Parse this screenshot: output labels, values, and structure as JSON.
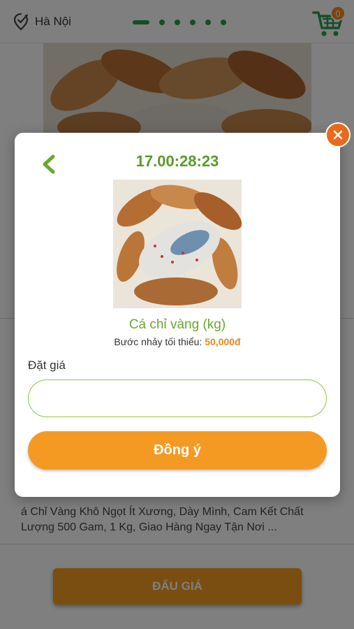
{
  "header": {
    "location": "Hà Nội",
    "cart_count": "0",
    "carousel_dots": 6
  },
  "background": {
    "description": "á Chỉ Vàng Khô Ngọt Ít Xương, Dày Mình, Cam Kết Chất Lượng 500 Gam, 1 Kg, Giao Hàng Ngay Tận Nơi ...",
    "auction_button": "ĐẤU GIÁ"
  },
  "modal": {
    "timer": "17.00:28:23",
    "product_name": "Cá chỉ vàng (kg)",
    "min_step_label": "Bước nhảy tối thiểu:",
    "min_step_value": "50,000đ",
    "price_label": "Đặt giá",
    "price_value": "",
    "price_placeholder": "",
    "confirm_label": "Đồng ý"
  },
  "colors": {
    "accent_green": "#6aa82e",
    "accent_orange": "#f49a23",
    "close_orange": "#ea6a1c"
  },
  "icons": {
    "location": "location-check-icon",
    "cart": "cart-icon",
    "back": "chevron-left-icon",
    "close": "close-icon"
  }
}
